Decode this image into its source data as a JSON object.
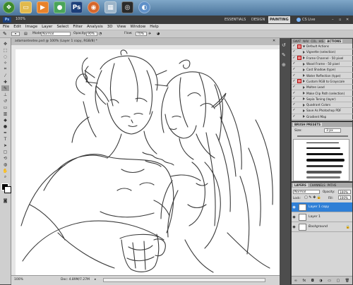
{
  "taskbar": {
    "icons": [
      "start-orb-icon",
      "folder-icon",
      "media-player-icon",
      "chrome-icon",
      "photoshop-icon",
      "firefox-icon",
      "unknown-app-icon",
      "steam-icon",
      "app-icon"
    ]
  },
  "appbar": {
    "zoom": "100%",
    "workspaces": [
      "ESSENTIALS",
      "DESIGN",
      "PAINTING"
    ],
    "active_workspace": "PAINTING",
    "cs_live": "CS Live"
  },
  "menu": [
    "File",
    "Edit",
    "Image",
    "Layer",
    "Select",
    "Filter",
    "Analysis",
    "3D",
    "View",
    "Window",
    "Help"
  ],
  "options": {
    "mode_label": "Mode:",
    "mode_value": "Normal",
    "opacity_label": "Opacity:",
    "opacity_value": "90%",
    "flow_label": "Flow:",
    "flow_value": "70%"
  },
  "document": {
    "tab_title": "adamantextex.psd @ 100% (Layer 1 copy, RGB/8) *",
    "zoom": "100%",
    "doc_info": "Doc: 4.89M/7.27M"
  },
  "actions_panel": {
    "tabs": [
      "SWAT",
      "NAV",
      "COL",
      "HIS",
      "ACTIONS"
    ],
    "active_tab": "ACTIONS",
    "set_name": "Default Actions",
    "items": [
      "Vignette (selection)",
      "Frame Channel - 50 pixel",
      "Wood Frame - 50 pixel",
      "Cast Shadow (type)",
      "Water Reflection (type)",
      "Custom RGB to Grayscale",
      "Molten Lead",
      "Make Clip Path (selection)",
      "Sepia Toning (layer)",
      "Quadrant Colors",
      "Save As Photoshop PDF",
      "Gradient Map"
    ]
  },
  "brush_panel": {
    "title": "BRUSH PRESETS",
    "size_label": "Size:",
    "size_value": "3 px"
  },
  "layers_panel": {
    "tabs": [
      "LAYERS",
      "CHANNELS",
      "PATHS"
    ],
    "blend_mode": "Normal",
    "opacity_label": "Opacity:",
    "opacity_value": "100%",
    "lock_label": "Lock:",
    "fill_label": "Fill:",
    "fill_value": "100%",
    "layers": [
      {
        "name": "Layer 1 copy",
        "selected": true
      },
      {
        "name": "Layer 1",
        "selected": false
      },
      {
        "name": "Background",
        "selected": false
      }
    ]
  },
  "colors": {
    "taskbar": "#5a82a8",
    "selected_layer": "#2f7fd6",
    "painting_highlight": "#ffffff"
  }
}
